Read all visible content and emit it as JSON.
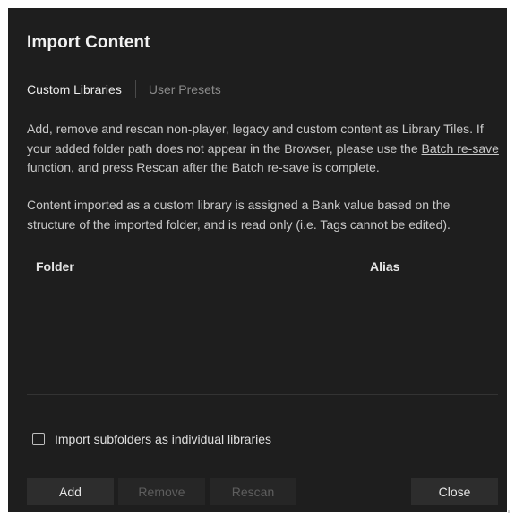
{
  "dialog": {
    "title": "Import Content",
    "tabs": [
      {
        "label": "Custom Libraries",
        "active": true
      },
      {
        "label": "User Presets",
        "active": false
      }
    ],
    "description": {
      "line_a": "Add, remove and rescan non-player, legacy and custom content as Library Tiles. If your added folder path does not appear in the Browser, please use the ",
      "link": "Batch re-save function",
      "line_b": ", and press Rescan after the Batch re-save is complete.",
      "paragraph2": "Content imported as a custom library is assigned a Bank value based on the structure of the imported folder, and is read only (i.e. Tags cannot be edited)."
    },
    "table": {
      "columns": [
        "Folder",
        "Alias"
      ],
      "rows": []
    },
    "checkbox": {
      "label": "Import subfolders as individual libraries",
      "checked": false
    },
    "buttons": {
      "add": "Add",
      "remove": "Remove",
      "rescan": "Rescan",
      "close": "Close"
    }
  },
  "colors": {
    "dialog_background": "#1e1e1e",
    "button_background": "#2d2d2d",
    "disabled_text": "#5e5e5e",
    "inactive_tab": "#8a8a8a"
  }
}
